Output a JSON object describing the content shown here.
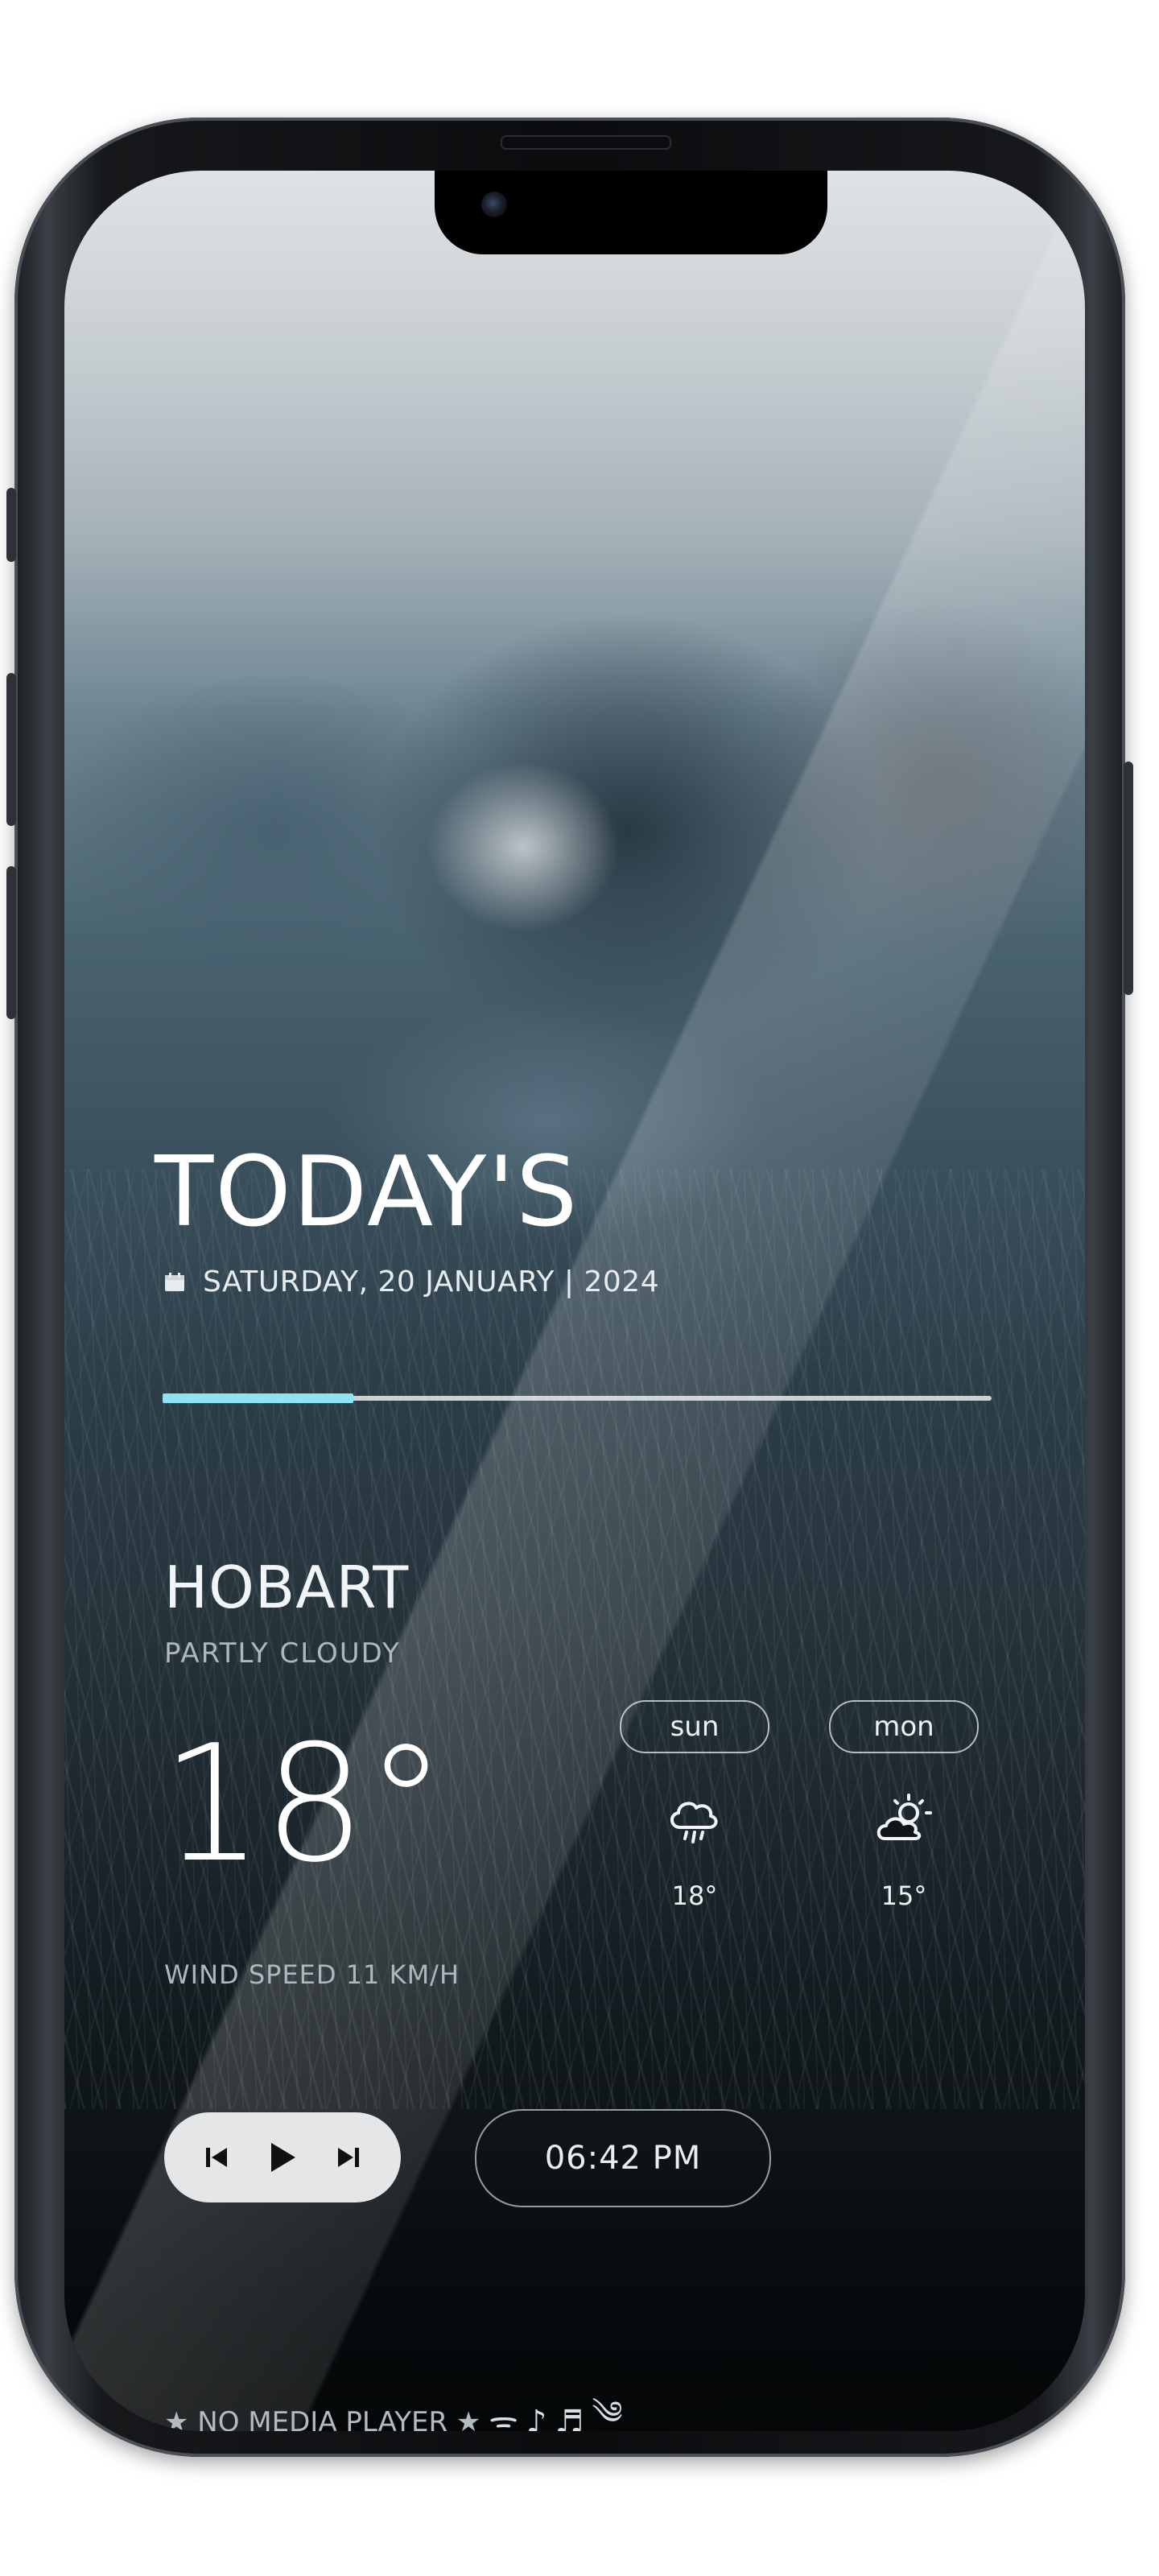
{
  "header": {
    "title": "TODAY'S",
    "date_text": "SATURDAY, 20 JANUARY | 2024",
    "calendar_icon": "calendar-icon"
  },
  "progress": {
    "fraction": 0.23,
    "fill_color": "#8fe3f2"
  },
  "weather": {
    "city": "HOBART",
    "condition": "PARTLY CLOUDY",
    "temperature": "18°",
    "wind": "WIND SPEED 11 KM/H"
  },
  "forecast": [
    {
      "day": "sun",
      "temp": "18°",
      "icon": "rain-cloud-icon"
    },
    {
      "day": "mon",
      "temp": "15°",
      "icon": "partly-cloudy-icon"
    }
  ],
  "media": {
    "prev_icon": "skip-previous-icon",
    "play_icon": "play-icon",
    "next_icon": "skip-next-icon"
  },
  "clock": {
    "time": "06:42 PM"
  },
  "footer": {
    "text": "★ NO MEDIA PLAYER ★",
    "icons": [
      "ᯤ",
      "♪",
      "♬",
      "༄"
    ]
  }
}
